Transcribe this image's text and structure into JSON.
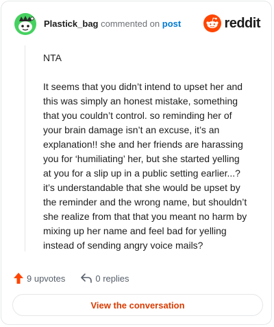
{
  "header": {
    "username": "Plastick_bag",
    "action_text": "commented on",
    "post_link": "post",
    "brand": "reddit",
    "avatar_icon": "snoo-avatar-icon",
    "brand_icon": "reddit-snoo-icon"
  },
  "comment": {
    "paragraphs": [
      "NTA",
      "It seems that you didn’t intend to upset her and this was simply an honest mistake, something that you couldn’t control. so reminding her of your brain damage isn’t an excuse, it’s an explanation!! she and her friends are harassing you for ‘humiliating’ her, but she started yelling at you for a slip up in a public setting earlier...? it’s understandable that she would be upset by the reminder and the wrong name, but shouldn’t she realize from that that you meant no harm by mixing up her name and feel bad for yelling instead of sending angry voice mails?"
    ]
  },
  "footer": {
    "upvotes": "9 upvotes",
    "replies": "0 replies",
    "upvote_icon": "upvote-arrow-icon",
    "reply_icon": "reply-arrow-icon"
  },
  "cta": {
    "label": "View the conversation"
  },
  "colors": {
    "accent": "#ff4500",
    "link": "#0079d3",
    "cta_text": "#d93a00",
    "avatar_green": "#46d160"
  }
}
